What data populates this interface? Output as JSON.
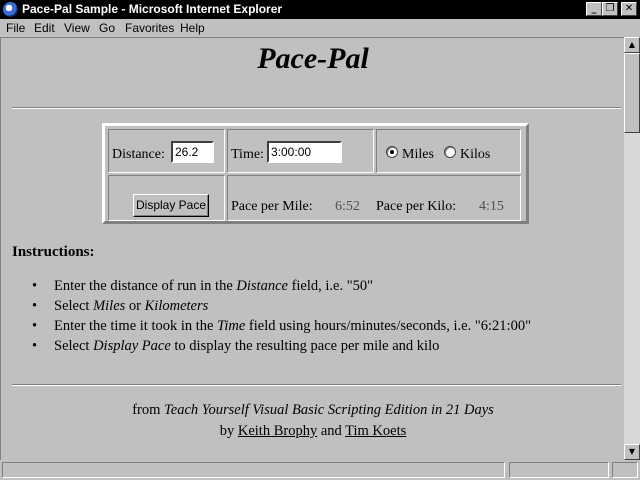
{
  "window": {
    "title": "Pace-Pal Sample - Microsoft Internet Explorer"
  },
  "menu": [
    "File",
    "Edit",
    "View",
    "Go",
    "Favorites",
    "Help"
  ],
  "page": {
    "title": "Pace-Pal",
    "form": {
      "distance_label": "Distance:",
      "distance_value": "26.2",
      "time_label": "Time:",
      "time_value": "3:00:00",
      "units": {
        "miles": "Miles",
        "kilos": "Kilos",
        "selected": "Miles"
      },
      "button_label": "Display Pace",
      "pace_mile_label": "Pace per Mile:",
      "pace_mile_value": "6:52",
      "pace_kilo_label": "Pace per Kilo:",
      "pace_kilo_value": "4:15"
    },
    "instructions": {
      "heading": "Instructions:",
      "items": [
        {
          "before": "Enter the distance of run in the ",
          "em": "Distance",
          "after": " field, i.e. \"50\""
        },
        {
          "before": "Select ",
          "em": "Miles",
          "mid": " or ",
          "em2": "Kilometers"
        },
        {
          "before": "Enter the time it took in the ",
          "em": "Time",
          "after": " field using hours/minutes/seconds, i.e. \"6:21:00\""
        },
        {
          "before": "Select ",
          "em": "Display Pace",
          "after": " to display the resulting pace per mile and kilo"
        }
      ]
    },
    "credit": {
      "from": "from ",
      "book": "Teach Yourself Visual Basic Scripting Edition in 21 Days",
      "by": "by ",
      "author1": "Keith Brophy",
      "and": " and ",
      "author2": "Tim Koets"
    }
  }
}
